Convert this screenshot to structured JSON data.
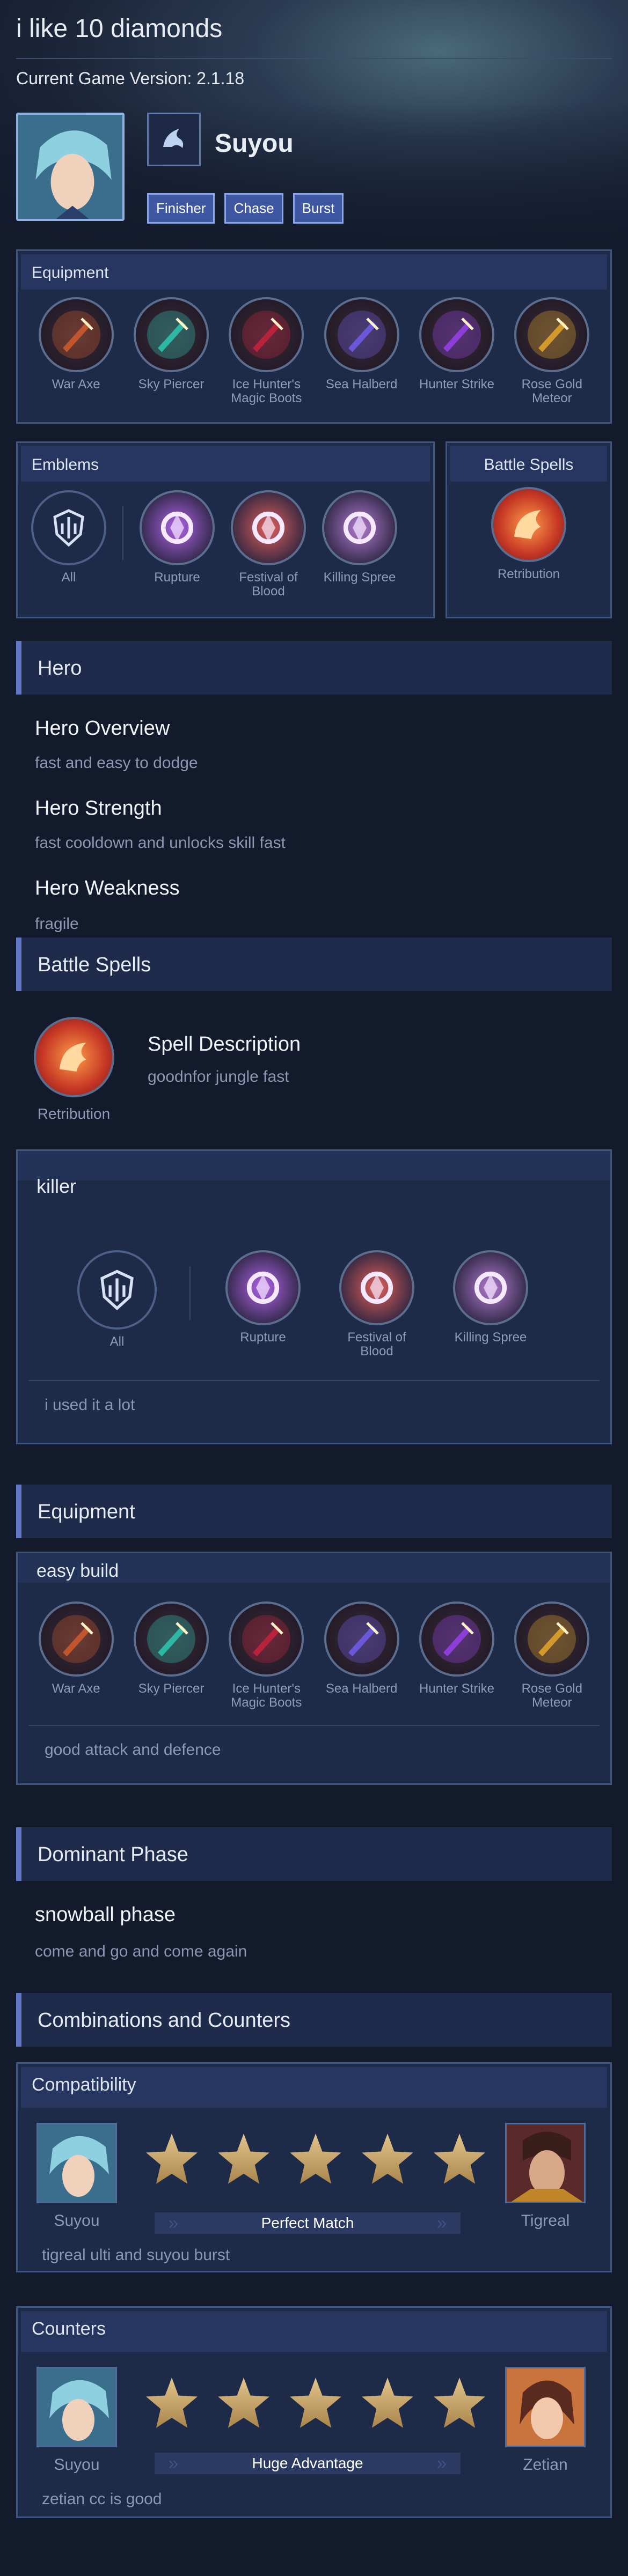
{
  "page_title": "i like 10 diamonds",
  "game_version": "Current Game Version: 2.1.18",
  "hero": {
    "name": "Suyou",
    "tags": [
      "Finisher",
      "Chase",
      "Burst"
    ],
    "role_icon": "assassin-icon"
  },
  "equipment_top": {
    "heading": "Equipment",
    "items": [
      {
        "label": "War Axe",
        "icon": "war-axe-icon",
        "color": "#c0562b"
      },
      {
        "label": "Sky Piercer",
        "icon": "sky-piercer-icon",
        "color": "#2fb7a5"
      },
      {
        "label": "Ice Hunter's Magic Boots",
        "icon": "magic-boots-icon",
        "color": "#b8233c"
      },
      {
        "label": "Sea Halberd",
        "icon": "sea-halberd-icon",
        "color": "#6a58d8"
      },
      {
        "label": "Hunter Strike",
        "icon": "hunter-strike-icon",
        "color": "#8b3fd6"
      },
      {
        "label": "Rose Gold Meteor",
        "icon": "rose-gold-meteor-icon",
        "color": "#d19a2a"
      }
    ]
  },
  "emblems_top": {
    "heading": "Emblems",
    "main": {
      "label": "All",
      "icon": "all-emblem-icon"
    },
    "talents": [
      {
        "label": "Rupture",
        "icon": "rupture-icon",
        "color": "#b065e8"
      },
      {
        "label": "Festival of Blood",
        "icon": "festival-of-blood-icon",
        "color": "#e0605a"
      },
      {
        "label": "Killing Spree",
        "icon": "killing-spree-icon",
        "color": "#b27bd0"
      }
    ]
  },
  "battle_spells_top": {
    "heading": "Battle Spells",
    "spell": {
      "label": "Retribution",
      "icon": "retribution-icon",
      "color": "#d6532a"
    }
  },
  "hero_section": {
    "heading": "Hero",
    "overview_title": "Hero Overview",
    "overview_text": "fast and easy to dodge",
    "strength_title": "Hero Strength",
    "strength_text": "fast cooldown and unlocks skill fast",
    "weakness_title": "Hero Weakness",
    "weakness_text": "fragile"
  },
  "battle_spells_section": {
    "heading": "Battle Spells",
    "spell_label": "Retribution",
    "desc_title": "Spell Description",
    "desc_text": "goodnfor jungle fast"
  },
  "emblem_card": {
    "title": "killer",
    "main_label": "All",
    "talents": [
      "Rupture",
      "Festival of Blood",
      "Killing Spree"
    ],
    "note": "i used it a lot"
  },
  "equipment_section": {
    "heading": "Equipment",
    "build_title": "easy build",
    "items": [
      "War Axe",
      "Sky Piercer",
      "Ice Hunter's Magic Boots",
      "Sea Halberd",
      "Hunter Strike",
      "Rose Gold Meteor"
    ],
    "note": "good attack and defence"
  },
  "dominant_phase": {
    "heading": "Dominant Phase",
    "title": "snowball phase",
    "text": "come and go and come again"
  },
  "combos": {
    "heading": "Combinations and Counters",
    "compat": {
      "heading": "Compatibility",
      "left": "Suyou",
      "right": "Tigreal",
      "rating": 5,
      "verdict": "Perfect Match",
      "note": "tigreal ulti and suyou burst"
    },
    "counters": {
      "heading": "Counters",
      "left": "Suyou",
      "right": "Zetian",
      "rating": 5,
      "verdict": "Huge Advantage",
      "note": "zetian cc is good"
    }
  },
  "colors": {
    "background": "#131a2c",
    "panel": "#1d2a48",
    "accent": "#5f77c4",
    "tag": "#3f56a3",
    "star": "#c9ab72"
  }
}
